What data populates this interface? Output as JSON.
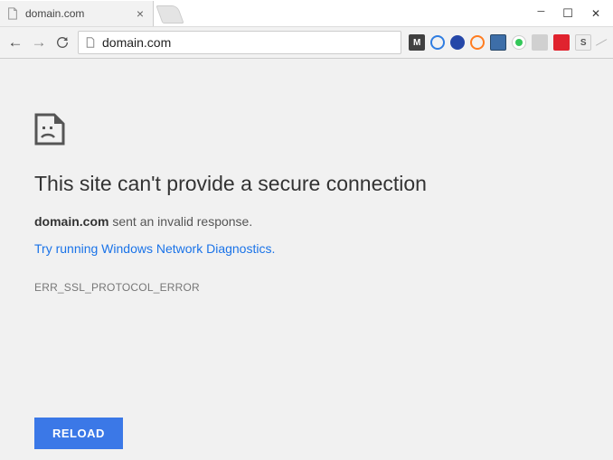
{
  "tab": {
    "title": "domain.com"
  },
  "address": {
    "url": "domain.com"
  },
  "extensions": [
    "M",
    "",
    "",
    "",
    "",
    "",
    "",
    "",
    "S"
  ],
  "error": {
    "heading": "This site can't provide a secure connection",
    "host": "domain.com",
    "host_suffix": " sent an invalid response.",
    "diagnostics_link": "Try running Windows Network Diagnostics.",
    "code": "ERR_SSL_PROTOCOL_ERROR",
    "reload_label": "RELOAD"
  }
}
